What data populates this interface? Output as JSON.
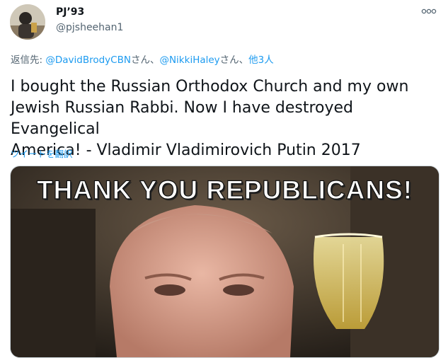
{
  "author": {
    "display_name": "PJ’93",
    "handle": "@pjsheehan1",
    "avatar_icon": "avatar-photo"
  },
  "more_icon": "more-options-icon",
  "reply": {
    "prefix": "返信先: ",
    "mention1": "@DavidBrodyCBN",
    "sep1": "さん、",
    "mention2": "@NikkiHaley",
    "sep2": "さん、",
    "others": "他3人"
  },
  "tweet": {
    "text": "I bought the Russian Orthodox Church and my own\nJewish Russian Rabbi. Now I have destroyed Evangelical\nAmerica! - Vladimir Vladimirovich Putin 2017"
  },
  "translate_label": "ツイートを翻訳",
  "media": {
    "headline": "THANK YOU REPUBLICANS!"
  },
  "colors": {
    "link": "#1d9bf0",
    "secondary_text": "#536471",
    "primary_text": "#0f1419"
  }
}
